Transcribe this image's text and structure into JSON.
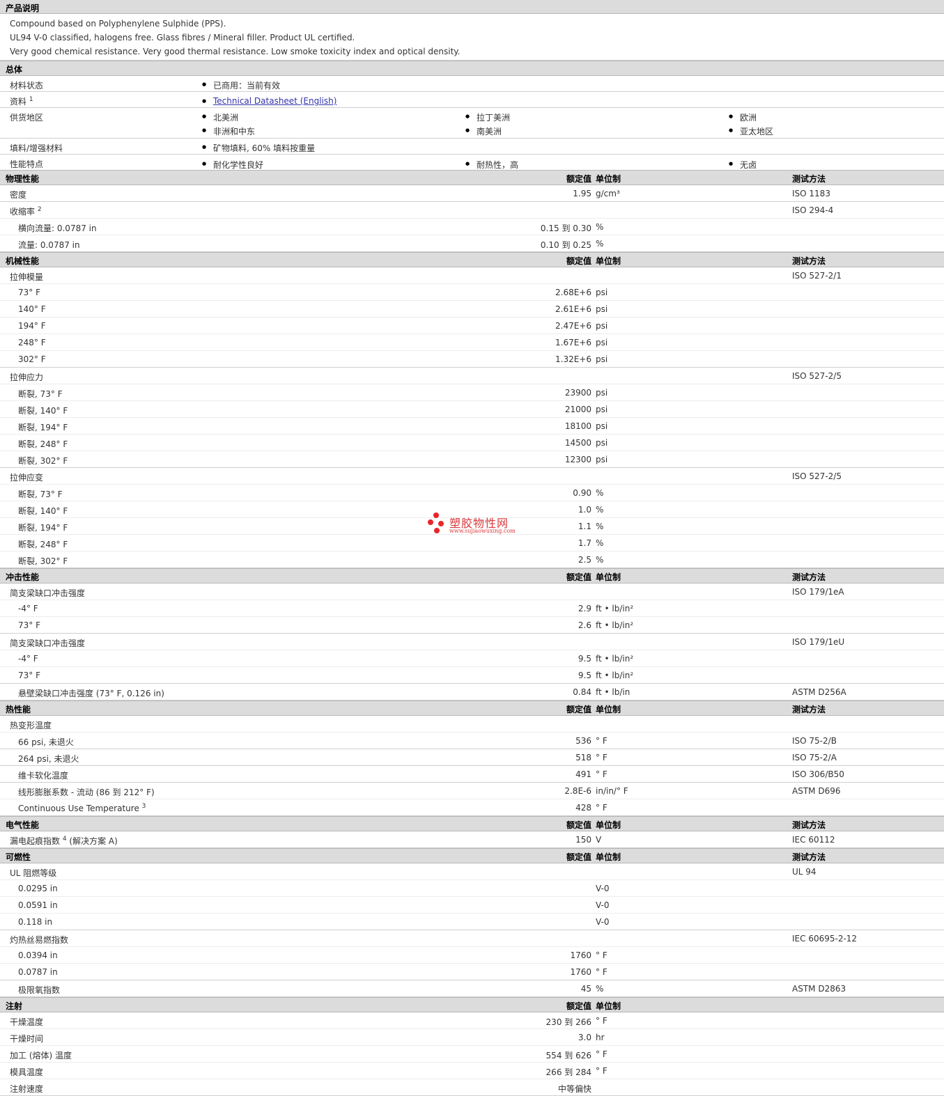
{
  "description": {
    "heading": "产品说明",
    "lines": [
      "Compound based on Polyphenylene Sulphide (PPS).",
      "UL94 V-0 classified, halogens free. Glass fibres / Mineral filler. Product UL certified.",
      "Very good chemical resistance. Very good thermal resistance. Low smoke toxicity index and optical density."
    ]
  },
  "general": {
    "heading": "总体",
    "status_label": "材料状态",
    "status_value": "已商用：当前有效",
    "docs_label": "资料",
    "docs_sup": "1",
    "docs_link": "Technical Datasheet (English)",
    "regions_label": "供货地区",
    "regions": [
      "北美洲",
      "拉丁美洲",
      "欧洲",
      "非洲和中东",
      "南美洲",
      "亚太地区"
    ],
    "filler_label": "填料/增强材料",
    "filler_value": "矿物填料, 60% 填料按重量",
    "features_label": "性能特点",
    "features": [
      "耐化学性良好",
      "耐热性，高",
      "无卤"
    ]
  },
  "col_headers": {
    "value": "额定值",
    "unit": "单位制",
    "method": "测试方法"
  },
  "physical": {
    "heading": "物理性能",
    "rows": [
      {
        "label": "密度",
        "value": "1.95",
        "unit": "g/cm³",
        "method": "ISO 1183"
      },
      {
        "label": "收缩率",
        "sup": "2",
        "method": "ISO 294-4"
      },
      {
        "label": "横向流量: 0.0787 in",
        "value": "0.15 到  0.30",
        "unit": "%"
      },
      {
        "label": "流量: 0.0787 in",
        "value": "0.10 到  0.25",
        "unit": "%"
      }
    ]
  },
  "mechanical": {
    "heading": "机械性能",
    "rows": [
      {
        "label": "拉伸模量",
        "method": "ISO 527-2/1"
      },
      {
        "label": "73°  F",
        "value": "2.68E+6",
        "unit": "psi"
      },
      {
        "label": "140°  F",
        "value": "2.61E+6",
        "unit": "psi"
      },
      {
        "label": "194°  F",
        "value": "2.47E+6",
        "unit": "psi"
      },
      {
        "label": "248°  F",
        "value": "1.67E+6",
        "unit": "psi"
      },
      {
        "label": "302°  F",
        "value": "1.32E+6",
        "unit": "psi"
      },
      {
        "label": "拉伸应力",
        "method": "ISO 527-2/5"
      },
      {
        "label": "断裂, 73°  F",
        "value": "23900",
        "unit": "psi"
      },
      {
        "label": "断裂, 140°  F",
        "value": "21000",
        "unit": "psi"
      },
      {
        "label": "断裂, 194°  F",
        "value": "18100",
        "unit": "psi"
      },
      {
        "label": "断裂, 248°  F",
        "value": "14500",
        "unit": "psi"
      },
      {
        "label": "断裂, 302°  F",
        "value": "12300",
        "unit": "psi"
      },
      {
        "label": "拉伸应变",
        "method": "ISO 527-2/5"
      },
      {
        "label": "断裂, 73°  F",
        "value": "0.90",
        "unit": "%"
      },
      {
        "label": "断裂, 140°  F",
        "value": "1.0",
        "unit": "%"
      },
      {
        "label": "断裂, 194°  F",
        "value": "1.1",
        "unit": "%"
      },
      {
        "label": "断裂, 248°  F",
        "value": "1.7",
        "unit": "%"
      },
      {
        "label": "断裂, 302°  F",
        "value": "2.5",
        "unit": "%"
      }
    ]
  },
  "impact": {
    "heading": "冲击性能",
    "rows": [
      {
        "label": "简支梁缺口冲击强度",
        "method": "ISO 179/1eA"
      },
      {
        "label": "-4°  F",
        "value": "2.9",
        "unit": "ft • lb/in²"
      },
      {
        "label": "73°  F",
        "value": "2.6",
        "unit": "ft • lb/in²"
      },
      {
        "label": "简支梁缺口冲击强度",
        "method": "ISO 179/1eU"
      },
      {
        "label": "-4°  F",
        "value": "9.5",
        "unit": "ft • lb/in²"
      },
      {
        "label": "73°  F",
        "value": "9.5",
        "unit": "ft • lb/in²"
      },
      {
        "label": "悬壁梁缺口冲击强度 (73°  F, 0.126 in)",
        "value": "0.84",
        "unit": "ft • lb/in",
        "method": "ASTM D256A"
      }
    ]
  },
  "thermal": {
    "heading": "热性能",
    "rows": [
      {
        "label": "热变形温度"
      },
      {
        "label": "66 psi, 未退火",
        "value": "536",
        "unit": "°  F",
        "method": "ISO 75-2/B"
      },
      {
        "label": "264 psi, 未退火",
        "value": "518",
        "unit": "°  F",
        "method": "ISO 75-2/A"
      },
      {
        "label": "维卡软化温度",
        "value": "491",
        "unit": "°  F",
        "method": "ISO 306/B50"
      },
      {
        "label": "线形膨胀系数 - 流动 (86 到  212°  F)",
        "value": "2.8E-6",
        "unit": "in/in/°  F",
        "method": "ASTM D696"
      },
      {
        "label": "Continuous Use Temperature",
        "sup": "3",
        "value": "428",
        "unit": "°  F"
      }
    ]
  },
  "electrical": {
    "heading": "电气性能",
    "rows": [
      {
        "label": "漏电起痕指数",
        "sup": "4",
        "label2": "(解决方案  A)",
        "value": "150",
        "unit": "V",
        "method": "IEC 60112"
      }
    ]
  },
  "flammability": {
    "heading": "可燃性",
    "rows": [
      {
        "label": "UL 阻燃等级",
        "method": "UL 94"
      },
      {
        "label": "0.0295 in",
        "unit": "V-0"
      },
      {
        "label": "0.0591 in",
        "unit": "V-0"
      },
      {
        "label": "0.118 in",
        "unit": "V-0"
      },
      {
        "label": "灼热丝易燃指数",
        "method": "IEC 60695-2-12"
      },
      {
        "label": "0.0394 in",
        "value": "1760",
        "unit": "°  F"
      },
      {
        "label": "0.0787 in",
        "value": "1760",
        "unit": "°  F"
      },
      {
        "label": "极限氧指数",
        "value": "45",
        "unit": "%",
        "method": "ASTM D2863"
      }
    ]
  },
  "injection": {
    "heading": "注射",
    "rows": [
      {
        "label": "干燥温度",
        "value": "230 到  266",
        "unit": "°  F"
      },
      {
        "label": "干燥时间",
        "value": "3.0",
        "unit": "hr"
      },
      {
        "label": "加工 (熔体) 温度",
        "value": "554 到  626",
        "unit": "°  F"
      },
      {
        "label": "模具温度",
        "value": "266 到  284",
        "unit": "°  F"
      },
      {
        "label": "注射速度",
        "value": "中等偏快"
      }
    ]
  },
  "watermark": {
    "name": "塑胶物性网",
    "url": "www.sujiaowuxing.com",
    "color": "#e8242a"
  }
}
